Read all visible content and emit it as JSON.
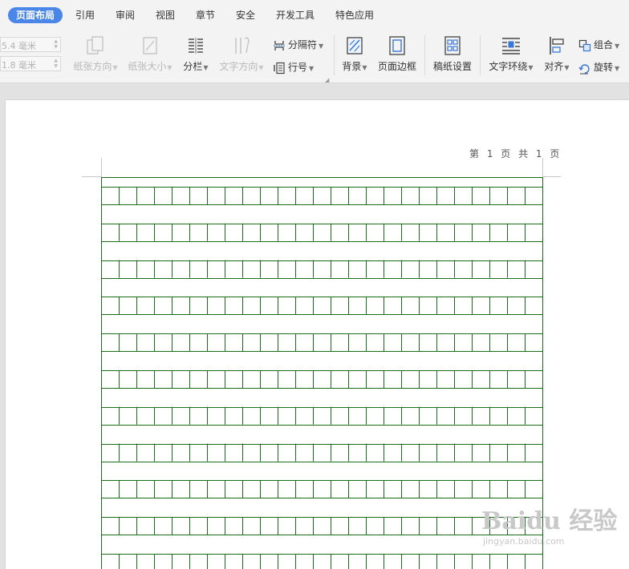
{
  "tabs": [
    {
      "label": "页面布局",
      "active": true
    },
    {
      "label": "引用"
    },
    {
      "label": "审阅"
    },
    {
      "label": "视图"
    },
    {
      "label": "章节"
    },
    {
      "label": "安全"
    },
    {
      "label": "开发工具"
    },
    {
      "label": "特色应用"
    }
  ],
  "ribbon": {
    "margin_top_value": "5.4 毫米",
    "margin_bottom_value": "1.8 毫米",
    "orientation_label": "纸张方向",
    "paper_size_label": "纸张大小",
    "columns_label": "分栏",
    "text_direction_label": "文字方向",
    "separator_label": "分隔符",
    "line_number_label": "行号",
    "background_label": "背景",
    "page_border_label": "页面边框",
    "grid_paper_label": "稿纸设置",
    "text_wrap_label": "文字环绕",
    "align_label": "对齐",
    "group_label": "组合",
    "rotate_label": "旋转",
    "icons": {
      "orientation": "paper-orientation-icon",
      "paper_size": "paper-size-icon",
      "columns": "columns-icon",
      "text_direction": "text-direction-icon",
      "separator": "separator-icon",
      "line_number": "line-number-icon",
      "background": "background-icon",
      "page_border": "page-border-icon",
      "grid_paper": "grid-paper-icon",
      "text_wrap": "text-wrap-icon",
      "align": "align-icon",
      "group": "group-icon",
      "rotate": "rotate-icon"
    }
  },
  "document": {
    "header_text": "第 1 页 共 1 页",
    "grid": {
      "columns": 25,
      "rows_visible": 11,
      "color": "#1a6e1a"
    }
  },
  "watermark": {
    "text": "Baidu 经验",
    "sub_text": "jingyan.baidu.com"
  },
  "colors": {
    "accent": "#4a86e8",
    "grid_line": "#1a6e1a",
    "disabled_text": "#b8b8b8"
  }
}
